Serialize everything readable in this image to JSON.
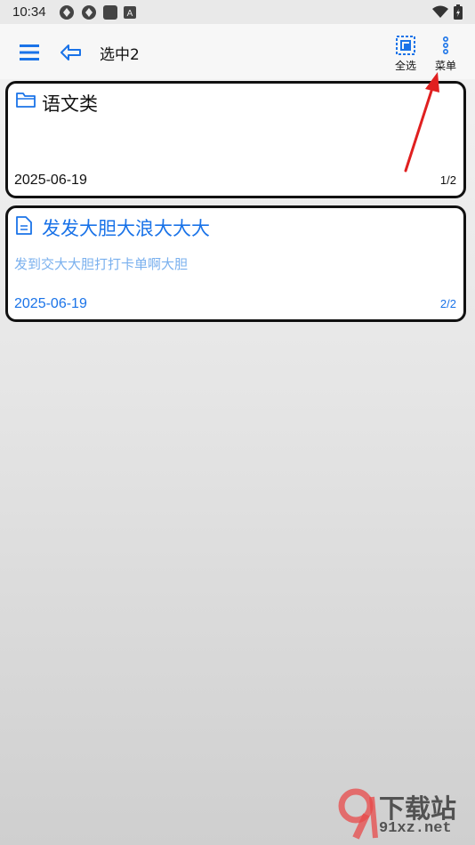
{
  "status_bar": {
    "time": "10:34"
  },
  "toolbar": {
    "title": "选中2",
    "select_all_label": "全选",
    "menu_label": "菜单"
  },
  "cards": [
    {
      "title": "语文类",
      "body": "",
      "date": "2025-06-19",
      "page": "1/2",
      "type": "folder"
    },
    {
      "title": "发发大胆大浪大大大",
      "body": "发到交大大胆打打卡单啊大胆",
      "date": "2025-06-19",
      "page": "2/2",
      "type": "note"
    }
  ],
  "watermark": {
    "text": "下载站",
    "domain": "91xz.net"
  },
  "colors": {
    "accent": "#1a73e8",
    "body_text": "#7ab0ee",
    "arrow": "#e02020"
  }
}
